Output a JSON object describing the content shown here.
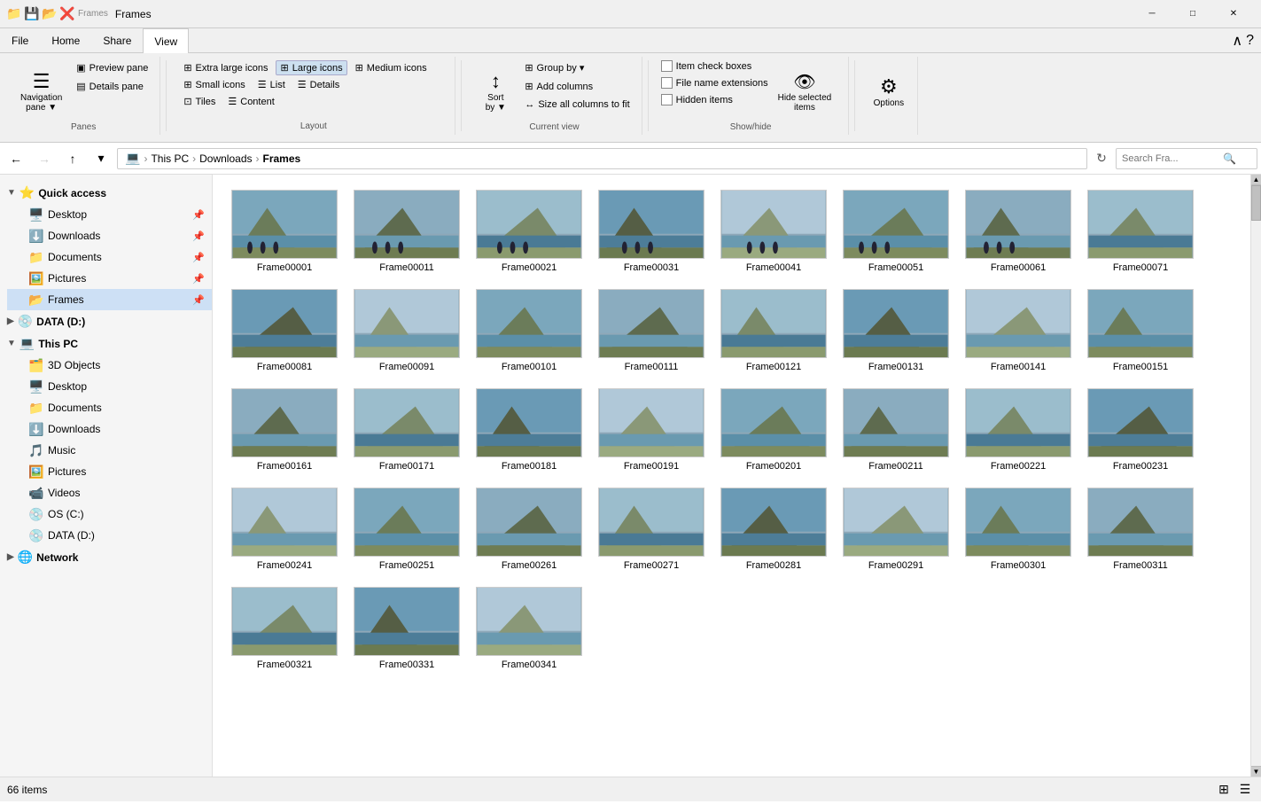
{
  "titlebar": {
    "title": "Frames",
    "icons": [
      "📁",
      "💾",
      "📂",
      "❌"
    ],
    "min": "─",
    "max": "□",
    "close": "✕"
  },
  "ribbon": {
    "tabs": [
      "File",
      "Home",
      "Share",
      "View"
    ],
    "active_tab": "View",
    "groups": {
      "panes": {
        "label": "Panes",
        "navigation_pane": "Navigation\npane",
        "preview_pane": "Preview pane",
        "details_pane": "Details pane"
      },
      "layout": {
        "label": "Layout",
        "items": [
          {
            "id": "extra-large",
            "label": "Extra large icons"
          },
          {
            "id": "large",
            "label": "Large icons",
            "active": true
          },
          {
            "id": "medium",
            "label": "Medium icons"
          },
          {
            "id": "small",
            "label": "Small icons"
          },
          {
            "id": "list",
            "label": "List"
          },
          {
            "id": "details",
            "label": "Details"
          },
          {
            "id": "tiles",
            "label": "Tiles"
          },
          {
            "id": "content",
            "label": "Content"
          }
        ]
      },
      "current_view": {
        "label": "Current view",
        "sort_by": "Sort\nby",
        "group_by": "Group by",
        "add_columns": "Add columns",
        "size_all": "Size all columns to fit"
      },
      "show_hide": {
        "label": "Show/hide",
        "item_check_boxes": "Item check boxes",
        "file_name_extensions": "File name extensions",
        "hidden_items": "Hidden items",
        "hide_selected": "Hide selected\nitems"
      },
      "options": {
        "label": "",
        "options": "Options"
      }
    }
  },
  "address_bar": {
    "back_disabled": false,
    "forward_disabled": true,
    "up": "↑",
    "path": [
      "This PC",
      "Downloads",
      "Frames"
    ],
    "search_placeholder": "Search Fra...",
    "search_value": ""
  },
  "sidebar": {
    "sections": [
      {
        "id": "quick-access",
        "label": "Quick access",
        "expanded": true,
        "items": [
          {
            "id": "desktop-qa",
            "label": "Desktop",
            "icon": "🖥️",
            "pinned": true
          },
          {
            "id": "downloads-qa",
            "label": "Downloads",
            "icon": "⬇️",
            "pinned": true,
            "active": false
          },
          {
            "id": "documents-qa",
            "label": "Documents",
            "icon": "📁",
            "pinned": true
          },
          {
            "id": "pictures-qa",
            "label": "Pictures",
            "icon": "🖼️",
            "pinned": true
          },
          {
            "id": "frames-qa",
            "label": "Frames",
            "icon": "📂",
            "pinned": true,
            "active": true
          }
        ]
      },
      {
        "id": "data-d",
        "label": "DATA (D:)",
        "icon": "💿",
        "items": []
      },
      {
        "id": "this-pc",
        "label": "This PC",
        "expanded": true,
        "items": [
          {
            "id": "3d-objects",
            "label": "3D Objects",
            "icon": "🗂️"
          },
          {
            "id": "desktop-pc",
            "label": "Desktop",
            "icon": "🖥️"
          },
          {
            "id": "documents-pc",
            "label": "Documents",
            "icon": "📁"
          },
          {
            "id": "downloads-pc",
            "label": "Downloads",
            "icon": "⬇️"
          },
          {
            "id": "music-pc",
            "label": "Music",
            "icon": "🎵"
          },
          {
            "id": "pictures-pc",
            "label": "Pictures",
            "icon": "🖼️"
          },
          {
            "id": "videos-pc",
            "label": "Videos",
            "icon": "📹"
          },
          {
            "id": "os-c",
            "label": "OS (C:)",
            "icon": "💿"
          },
          {
            "id": "data-d-pc",
            "label": "DATA (D:)",
            "icon": "💿"
          }
        ]
      },
      {
        "id": "network",
        "label": "Network",
        "icon": "🌐",
        "items": []
      }
    ]
  },
  "files": {
    "items": [
      "Frame00001",
      "Frame00011",
      "Frame00021",
      "Frame00031",
      "Frame00041",
      "Frame00051",
      "Frame00061",
      "Frame00071",
      "Frame00081",
      "Frame00091",
      "Frame00101",
      "Frame00111",
      "Frame00121",
      "Frame00131",
      "Frame00141",
      "Frame00151",
      "Frame00161",
      "Frame00171",
      "Frame00181",
      "Frame00191",
      "Frame00201",
      "Frame00211",
      "Frame00221",
      "Frame00231",
      "Frame00241",
      "Frame00251",
      "Frame00261",
      "Frame00271",
      "Frame00281",
      "Frame00291",
      "Frame00301",
      "Frame00311",
      "Frame00321",
      "Frame00331",
      "Frame00341"
    ]
  },
  "status_bar": {
    "count": "66 items"
  }
}
